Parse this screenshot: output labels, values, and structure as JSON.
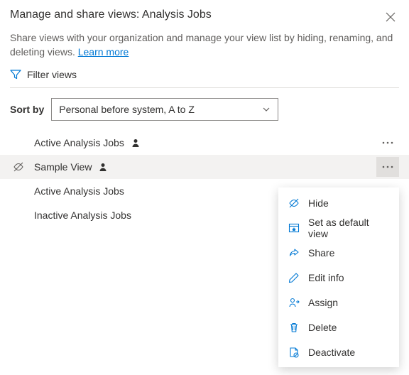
{
  "header": {
    "title": "Manage and share views: Analysis Jobs",
    "description_pre": "Share views with your organization and manage your view list by hiding, renaming, and deleting views. ",
    "learn_more": "Learn more"
  },
  "filter": {
    "label": "Filter views"
  },
  "sort": {
    "label": "Sort by",
    "selected": "Personal before system, A to Z"
  },
  "views": [
    {
      "label": "Active Analysis Jobs",
      "personal": true,
      "hidden": false,
      "selected": false,
      "has_more": true
    },
    {
      "label": "Sample View",
      "personal": true,
      "hidden": true,
      "selected": true,
      "has_more": true
    },
    {
      "label": "Active Analysis Jobs",
      "personal": false,
      "hidden": false,
      "selected": false,
      "has_more": false
    },
    {
      "label": "Inactive Analysis Jobs",
      "personal": false,
      "hidden": false,
      "selected": false,
      "has_more": false
    }
  ],
  "menu": {
    "hide": "Hide",
    "set_default": "Set as default view",
    "share": "Share",
    "edit": "Edit info",
    "assign": "Assign",
    "delete": "Delete",
    "deactivate": "Deactivate"
  }
}
